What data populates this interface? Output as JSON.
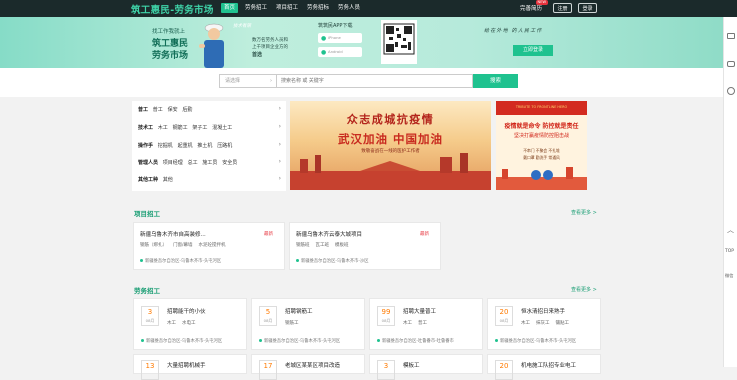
{
  "header": {
    "logo": "筑工惠民-劳务市场",
    "nav": [
      {
        "label": "首页",
        "active": true
      },
      {
        "label": "劳务招工"
      },
      {
        "label": "项目招工"
      },
      {
        "label": "劳务招标"
      },
      {
        "label": "劳务人员"
      }
    ],
    "user": "完善简历",
    "badge": "NEW",
    "register": "注册",
    "login": "登录"
  },
  "banner": {
    "line1": "找工作我就上",
    "line2": "筑工惠民",
    "line3": "劳务市场",
    "sign": "技术有限",
    "desc1": "数万名劳务人员和",
    "desc2": "上千项目企业方的",
    "desc3": "首选",
    "app_title": "筑筑民APP下载",
    "btn_iphone": "iPhone",
    "btn_android": "Android",
    "slogan": "给在外地 的人民工作",
    "cta": "立即登录"
  },
  "search": {
    "select": "请选择",
    "placeholder": "搜索名称 或 关键字",
    "button": "搜索"
  },
  "categories": [
    {
      "head": "普工",
      "items": [
        "普工",
        "保安",
        "后勤"
      ]
    },
    {
      "head": "技术工",
      "items": [
        "木工",
        "钢筋工",
        "架子工",
        "混凝土工"
      ]
    },
    {
      "head": "操作手",
      "items": [
        "挖掘机",
        "起重机",
        "推土机",
        "压路机"
      ]
    },
    {
      "head": "管理人员",
      "items": [
        "项目经理",
        "总工",
        "施工员",
        "安全员"
      ]
    },
    {
      "head": "其他工种",
      "items": [
        "其他"
      ]
    }
  ],
  "poster1": {
    "title1": "众志成城抗疫情",
    "title2": "武汉加油 中国加油",
    "sub": "致敬奋战在一线的医护工作者"
  },
  "poster2": {
    "top": "TRIBUTE TO FRONTLINE HERO",
    "line1": "疫情就是命令 防控就是责任",
    "line2": "坚决打赢疫情防控阻击战",
    "note1": "不串门 不聚会 不扎堆",
    "note2": "戴口罩 勤洗手 常通风"
  },
  "projects": {
    "title": "项目招工",
    "more": "查看更多 >",
    "cards": [
      {
        "title": "新疆乌鲁木齐市自高装修...",
        "tag": "最新",
        "meta": [
          "钢筋（绑扎）",
          "门窗/幕墙",
          "水泥砼搅拌机"
        ],
        "loc": "新疆维吾尔自治区-乌鲁木齐市-头屯河区"
      },
      {
        "title": "新疆乌鲁木齐云泰大城项目",
        "tag": "最新",
        "meta": [
          "钢筋班",
          "瓦工班",
          "模板班"
        ],
        "loc": "新疆维吾尔自治区-乌鲁木齐市-沙区"
      }
    ]
  },
  "labor": {
    "title": "劳务招工",
    "more": "查看更多 >",
    "cards": [
      {
        "day": "3",
        "mon": "08月",
        "title": "招聘能干的小伙",
        "meta": [
          "木工",
          "水电工"
        ],
        "loc": "新疆维吾尔自治区-乌鲁木齐市-头屯河区"
      },
      {
        "day": "5",
        "mon": "08月",
        "title": "招聘钢筋工",
        "meta": [
          "钢筋工"
        ],
        "loc": "新疆维吾尔自治区-乌鲁木齐市-头屯河区"
      },
      {
        "day": "99",
        "mon": "08月",
        "title": "招聘大量普工",
        "meta": [
          "木工",
          "普工"
        ],
        "loc": "新疆维吾尔自治区-吐鲁番市-吐鲁番市"
      },
      {
        "day": "20",
        "mon": "08月",
        "title": "恒水清招日来熟手",
        "meta": [
          "木工",
          "抹灰工",
          "镶贴工"
        ],
        "loc": "新疆维吾尔自治区-乌鲁木齐市-头屯河区"
      }
    ],
    "row2": [
      {
        "day": "13",
        "title": "大量招聘机械手"
      },
      {
        "day": "17",
        "title": "老城区某某区项目改造"
      },
      {
        "day": "3",
        "title": "模板工"
      },
      {
        "day": "20",
        "title": "机电施工队招专业电工"
      }
    ]
  },
  "sidebar": {
    "top": "TOP",
    "wechat": "微信"
  }
}
